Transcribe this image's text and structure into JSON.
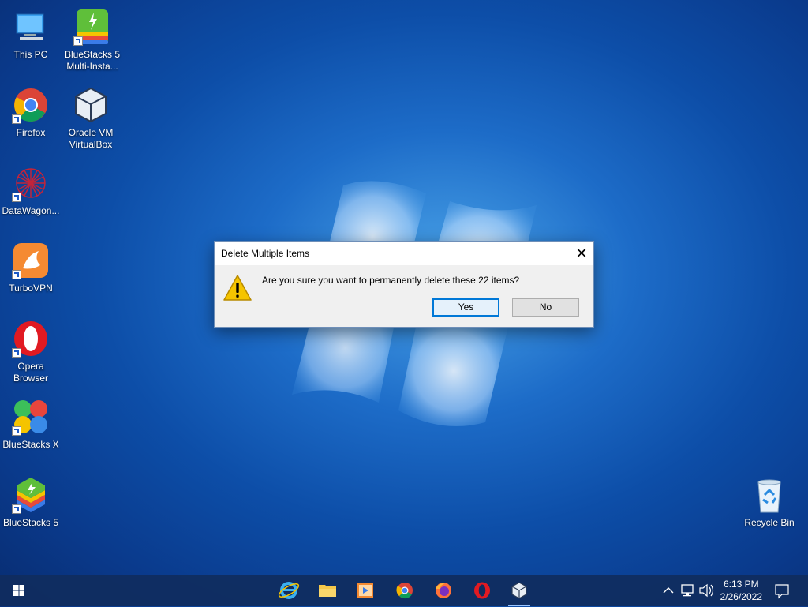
{
  "desktop": {
    "icons": [
      {
        "label": "This PC",
        "icon": "computer-icon"
      },
      {
        "label": "BlueStacks 5 Multi-Insta...",
        "icon": "bluestacks-multi-icon"
      },
      {
        "label": "Firefox",
        "icon": "chrome-icon"
      },
      {
        "label": "Oracle VM VirtualBox",
        "icon": "virtualbox-icon"
      },
      {
        "label": "DataWagon...",
        "icon": "datawagon-icon"
      },
      {
        "label": "TurboVPN",
        "icon": "turbovpn-icon"
      },
      {
        "label": "Opera Browser",
        "icon": "opera-icon"
      },
      {
        "label": "BlueStacks X",
        "icon": "bluestacks-x-icon"
      },
      {
        "label": "BlueStacks 5",
        "icon": "bluestacks-icon"
      },
      {
        "label": "Recycle Bin",
        "icon": "recycle-bin-icon"
      }
    ]
  },
  "dialog": {
    "title": "Delete Multiple Items",
    "close_glyph": "✕",
    "message": "Are you sure you want to permanently delete these 22 items?",
    "yes_label": "Yes",
    "no_label": "No"
  },
  "taskbar": {
    "apps": [
      "start-icon",
      "internet-explorer-icon",
      "file-explorer-icon",
      "media-player-icon",
      "chrome-icon",
      "firefox-icon",
      "opera-icon",
      "virtualbox-icon"
    ],
    "time": "6:13 PM",
    "date": "2/26/2022"
  },
  "colors": {
    "accent": "#0078d7",
    "warning": "#f5c400"
  }
}
